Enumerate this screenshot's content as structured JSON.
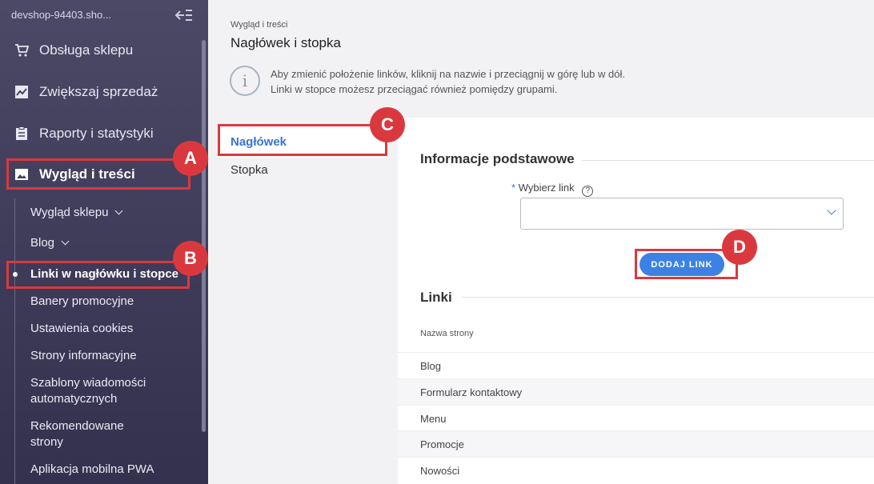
{
  "sidebar": {
    "shop_name": "devshop-94403.sho...",
    "items": [
      {
        "label": "Obsługa sklepu",
        "icon": "cart-icon"
      },
      {
        "label": "Zwiększaj sprzedaż",
        "icon": "chart-icon"
      },
      {
        "label": "Raporty i statystyki",
        "icon": "clipboard-icon"
      },
      {
        "label": "Wygląd i treści",
        "icon": "image-icon"
      }
    ],
    "subitems": [
      {
        "label": "Wygląd sklepu"
      },
      {
        "label": "Blog"
      },
      {
        "label": "Linki w nagłówku i stopce"
      },
      {
        "label": "Banery promocyjne"
      },
      {
        "label": "Ustawienia cookies"
      },
      {
        "label": "Strony informacyjne"
      },
      {
        "label": "Szablony wiadomości automatycznych"
      },
      {
        "label": "Rekomendowane strony"
      },
      {
        "label": "Aplikacja mobilna PWA"
      }
    ]
  },
  "header": {
    "breadcrumb": "Wygląd i treści",
    "title": "Nagłówek i stopka",
    "info_line1": "Aby zmienić położenie linków, kliknij na nazwie i przeciągnij w górę lub w dół.",
    "info_line2": "Linki w stopce możesz przeciągać również pomiędzy grupami."
  },
  "tabs": [
    {
      "label": "Nagłówek"
    },
    {
      "label": "Stopka"
    }
  ],
  "form": {
    "section_title": "Informacje podstawowe",
    "required_mark": "*",
    "select_label": "Wybierz link",
    "help_glyph": "?",
    "select_value": "",
    "add_button": "DODAJ LINK"
  },
  "links": {
    "section_title": "Linki",
    "column_header": "Nazwa strony",
    "rows": [
      "Blog",
      "Formularz kontaktowy",
      "Menu",
      "Promocje",
      "Nowości"
    ]
  },
  "callouts": [
    "A",
    "B",
    "C",
    "D"
  ],
  "colors": {
    "callout": "#d9393e",
    "accent": "#3d82e3",
    "sidebar": "#4c4967"
  }
}
